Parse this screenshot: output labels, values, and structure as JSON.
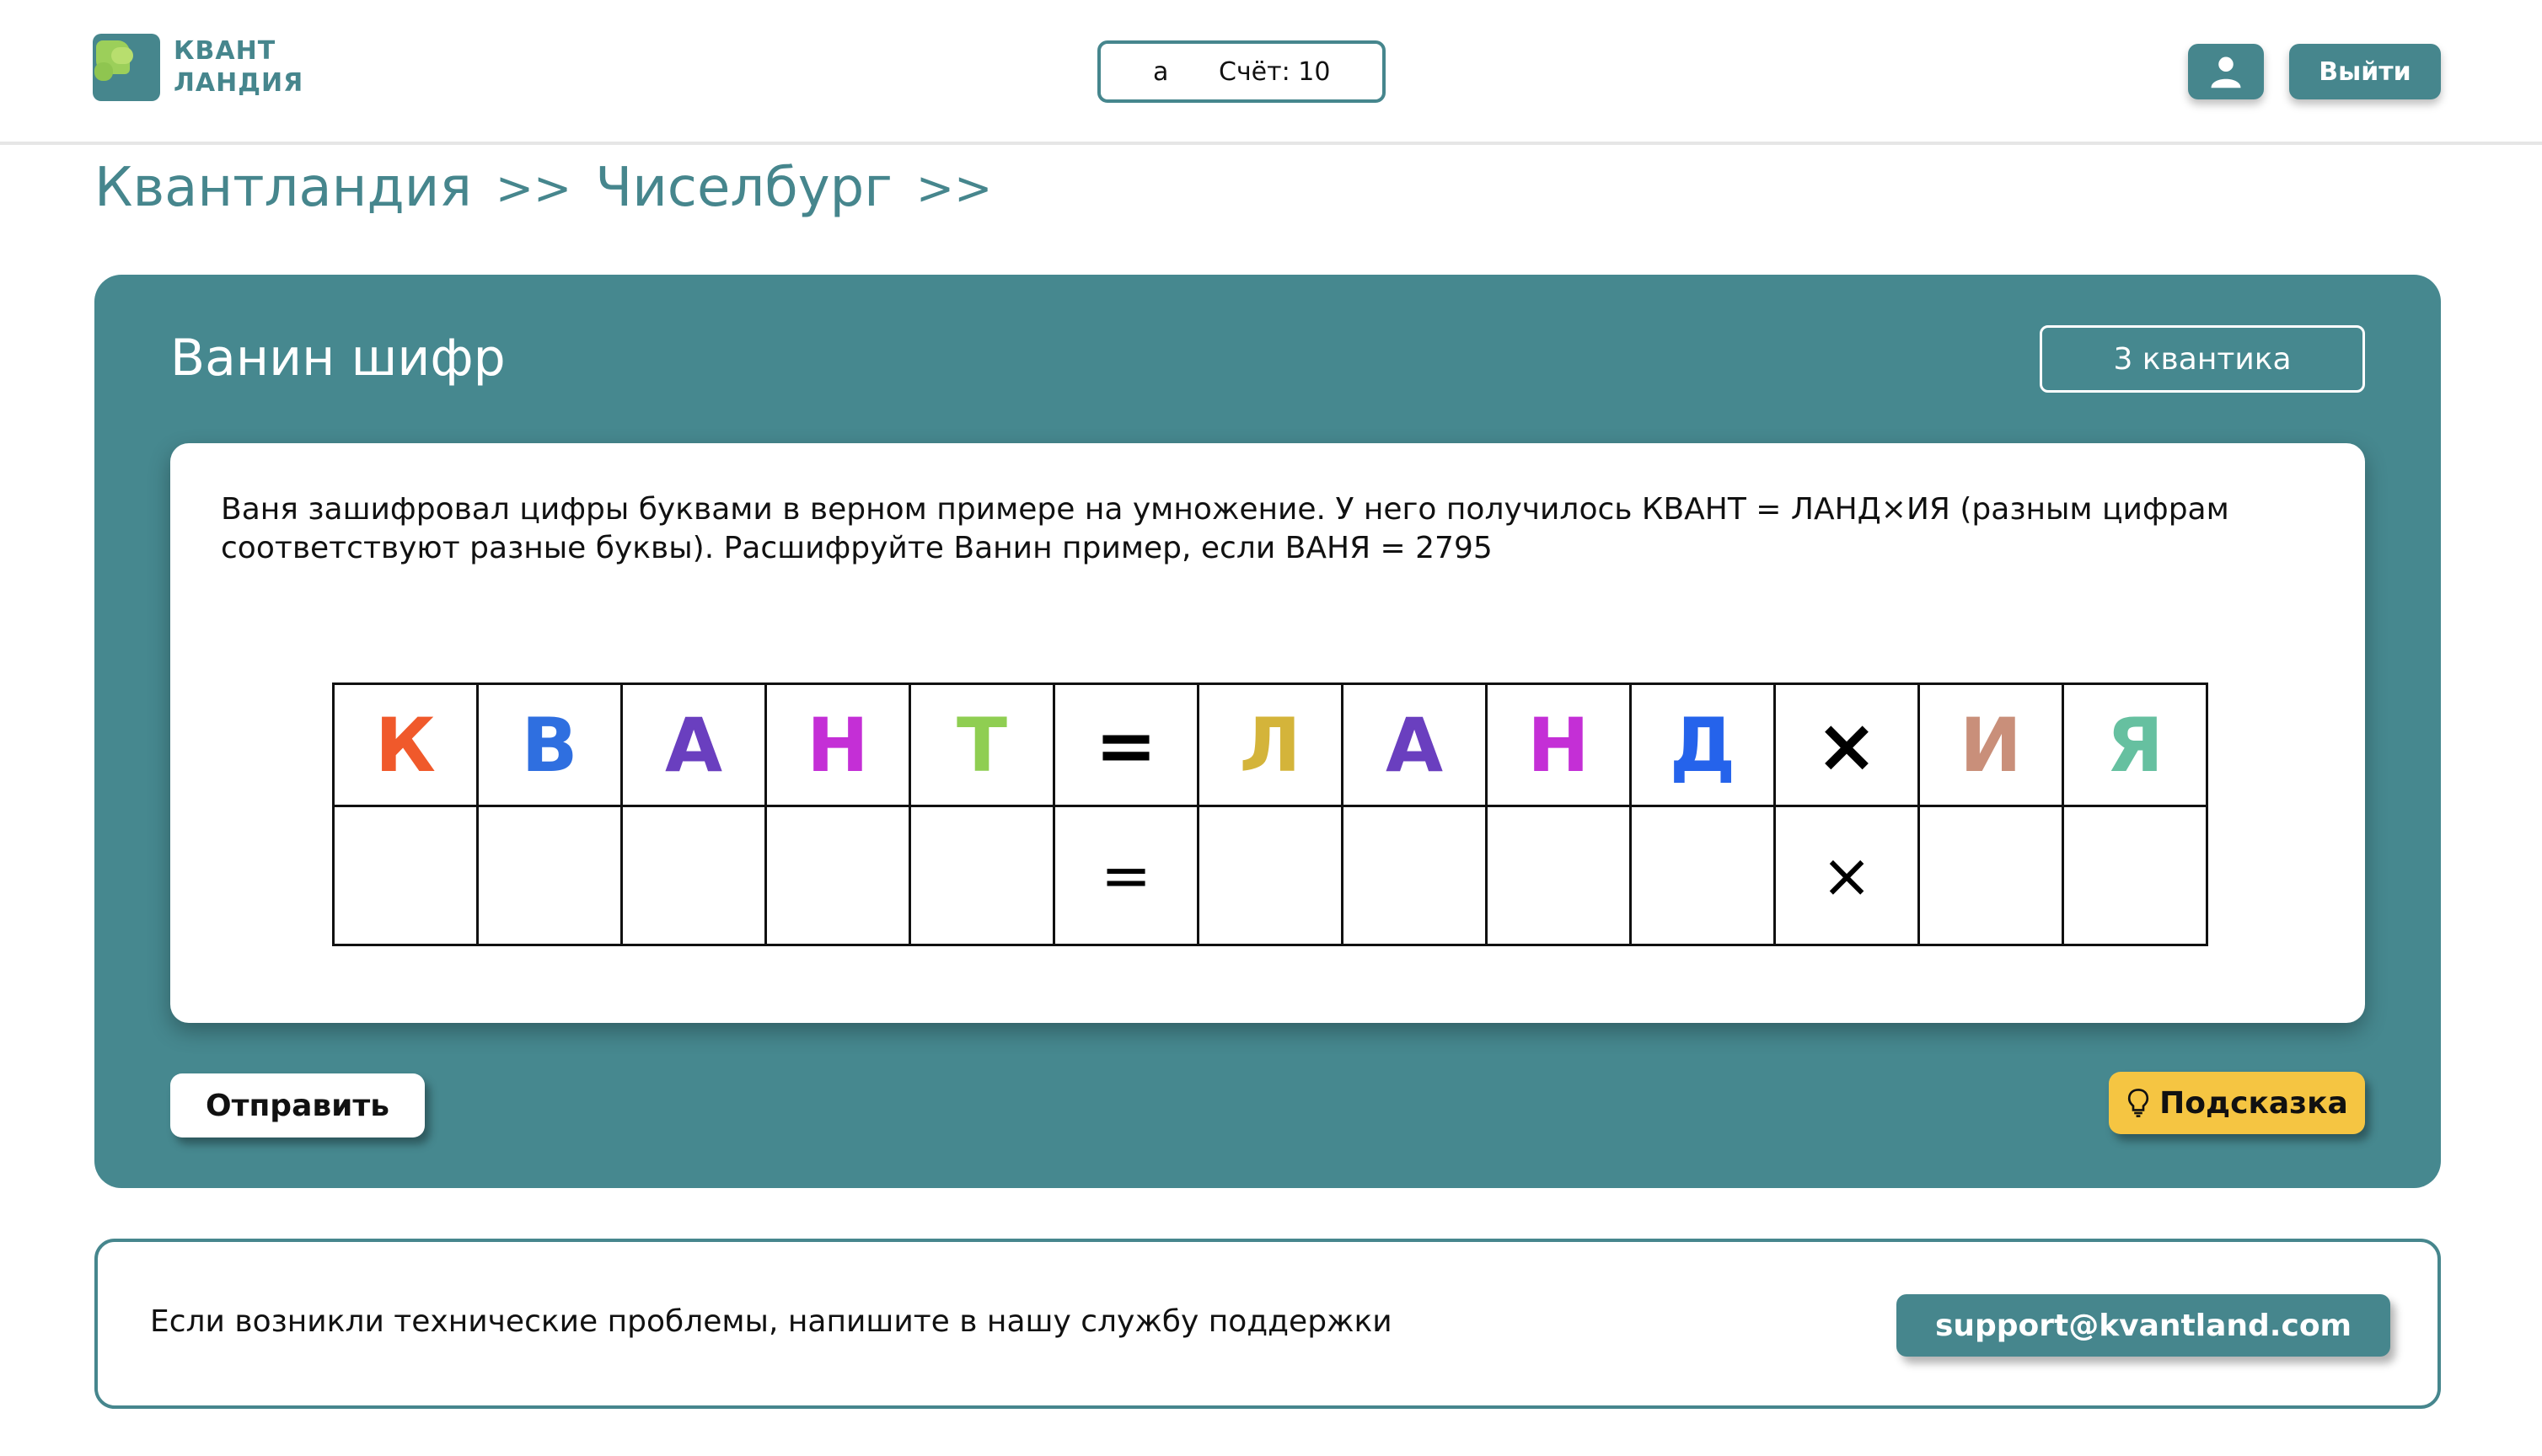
{
  "header": {
    "logo": {
      "line1": "КВАНТ",
      "line2": "ЛАНДИЯ"
    },
    "user_name": "а",
    "score_text": "Счёт: 10",
    "profile_icon": "user-icon",
    "logout_label": "Выйти"
  },
  "breadcrumb": {
    "items": [
      "Квантландия",
      "Чиселбург"
    ],
    "separator": ">>"
  },
  "task": {
    "title": "Ванин шифр",
    "points": "3 квантика",
    "description": "Ваня зашифровал цифры буквами в верном примере на умножение. У него получилось КВАНТ = ЛАНД×ИЯ (разным цифрам соответствуют разные буквы). Расшифруйте Ванин пример, если ВАНЯ = 2795",
    "cipher": {
      "letters": [
        {
          "char": "К",
          "color": "#f0592b"
        },
        {
          "char": "В",
          "color": "#2f6fe0"
        },
        {
          "char": "А",
          "color": "#6a3fbf"
        },
        {
          "char": "Н",
          "color": "#c42fd6"
        },
        {
          "char": "Т",
          "color": "#8fce52"
        },
        {
          "char": "=",
          "color": "#000000"
        },
        {
          "char": "Л",
          "color": "#d4b43a"
        },
        {
          "char": "А",
          "color": "#6a3fbf"
        },
        {
          "char": "Н",
          "color": "#c42fd6"
        },
        {
          "char": "Д",
          "color": "#2563eb"
        },
        {
          "char": "×",
          "color": "#000000"
        },
        {
          "char": "И",
          "color": "#c98f7a"
        },
        {
          "char": "Я",
          "color": "#66c0a0"
        }
      ],
      "answers": [
        "",
        "",
        "",
        "",
        "",
        "=",
        "",
        "",
        "",
        "",
        "×",
        "",
        ""
      ]
    },
    "submit_label": "Отправить",
    "hint_label": "Подсказка",
    "hint_icon": "lightbulb-icon"
  },
  "support": {
    "text": "Если возникли технические проблемы, напишите в нашу службу поддержки",
    "email": "support@kvantland.com"
  },
  "colors": {
    "accent": "#46868d",
    "hint": "#f5c542"
  }
}
